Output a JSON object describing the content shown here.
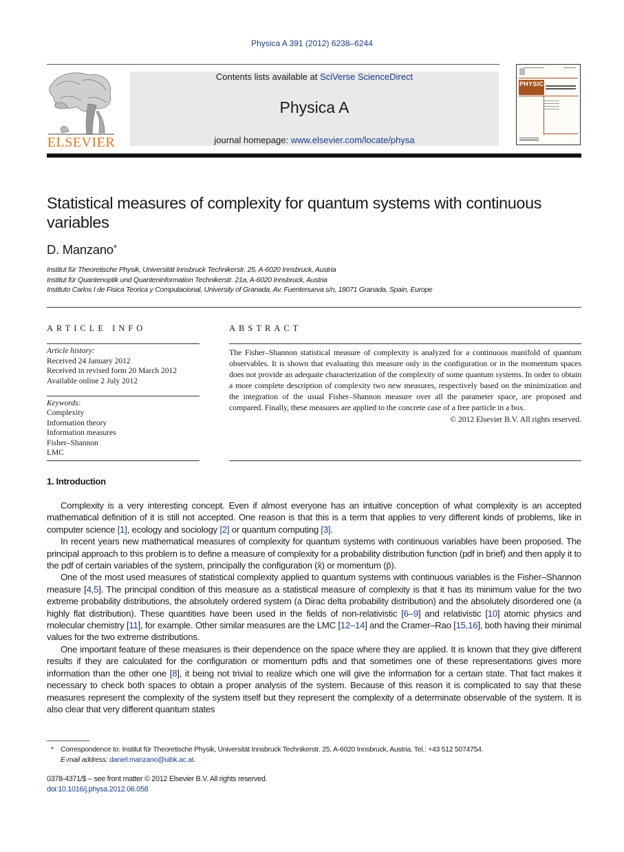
{
  "header": {
    "journal_ref": "Physica A 391 (2012) 6238–6244",
    "contents_prefix": "Contents lists available at ",
    "contents_link": "SciVerse ScienceDirect",
    "journal_title": "Physica A",
    "homepage_prefix": "journal homepage: ",
    "homepage_link": "www.elsevier.com/locate/physa",
    "publisher_wordmark": "ELSEVIER",
    "cover_title": "PHYSICA",
    "brand_color": "#e8741c",
    "link_color": "#1a3a8c"
  },
  "article": {
    "title": "Statistical measures of complexity for quantum systems with continuous variables",
    "author": "D. Manzano",
    "author_mark": "*",
    "affiliations": [
      "Institut für Theoretische Physik, Universität Innsbruck Technikerstr. 25, A-6020 Innsbruck, Austria",
      "Institut für Quantenoptik und Quanteninformation Technikerstr. 21a, A-6020 Innsbruck, Austria",
      "Instituto Carlos I de Fisica Teorica y Computacional, University of Granada, Av. Fuentenueva s/n, 18071 Granada, Spain, Europe"
    ]
  },
  "article_info": {
    "heading": "ARTICLE INFO",
    "history_label": "Article history:",
    "history": [
      "Received 24 January 2012",
      "Received in revised form 20 March 2012",
      "Available online 2 July 2012"
    ],
    "keywords_label": "Keywords:",
    "keywords": [
      "Complexity",
      "Information theory",
      "Information measures",
      "Fisher–Shannon",
      "LMC"
    ]
  },
  "abstract": {
    "heading": "ABSTRACT",
    "text": "The Fisher–Shannon statistical measure of complexity is analyzed for a continuous manifold of quantum observables. It is shown that evaluating this measure only in the configuration or in the momentum spaces does not provide an adequate characterization of the complexity of some quantum systems. In order to obtain a more complete description of complexity two new measures, respectively based on the minimization and the integration of the usual Fisher–Shannon measure over all the parameter space, are proposed and compared. Finally, these measures are applied to the concrete case of a free particle in a box.",
    "copyright": "© 2012 Elsevier B.V. All rights reserved."
  },
  "introduction": {
    "heading": "1.  Introduction",
    "p1": {
      "a": "Complexity is a very interesting concept. Even if almost everyone has an intuitive conception of what complexity is an accepted mathematical definition of it is still not accepted. One reason is that this is a term that applies to very different kinds of problems, like in computer science ",
      "c1": "[1]",
      "b": ", ecology and sociology ",
      "c2": "[2]",
      "c": " or quantum computing ",
      "c3": "[3]",
      "d": "."
    },
    "p2": "In recent years new mathematical measures of complexity for quantum systems with continuous variables have been proposed. The principal approach to this problem is to define a measure of complexity for a probability distribution function (pdf in brief) and then apply it to the pdf of certain variables of the system, principally the configuration (x̂) or momentum (p̂).",
    "p3": {
      "a": "One of the most used measures of statistical complexity applied to quantum systems with continuous variables is the Fisher–Shannon measure [",
      "c1": "4,5",
      "b": "]. The principal condition of this measure as a statistical measure of complexity is that it has its minimum value for the two extreme probability distributions, the absolutely ordered system (a Dirac delta probability distribution) and the absolutely disordered one (a highly flat distribution). These quantities have been used in the fields of non-relativistic [",
      "c2": "6–9",
      "c": "] and relativistic [",
      "c3": "10",
      "d": "] atomic physics and molecular chemistry [",
      "c4": "11",
      "e": "], for example. Other similar measures are the LMC [",
      "c5": "12–14",
      "f": "] and the Cramer–Rao [",
      "c6": "15,16",
      "g": "], both having their minimal values for the two extreme distributions."
    },
    "p4": {
      "a": "One important feature of these measures is their dependence on the space where they are applied. It is known that they give different results if they are calculated for the configuration or momentum pdfs and that sometimes one of these representations gives more information than the other one [",
      "c1": "8",
      "b": "], it being not trivial to realize which one will give the information for a certain state. That fact makes it necessary to check both spaces to obtain a proper analysis of the system. Because of this reason it is complicated to say that these measures represent the complexity of the system itself but they represent the complexity of a determinate observable of the system. It is also clear that very different quantum states"
    }
  },
  "footnote": {
    "mark": "*",
    "correspondence": "Correspondence to: Institut für Theoretische Physik, Universität Innsbruck Technikerstr. 25, A-6020 Innsbruck, Austria. Tel.: +43 512 5074754.",
    "email_label": "E-mail address:",
    "email": "daniel.manzano@uibk.ac.at",
    "email_suffix": "."
  },
  "front_matter": {
    "issn": "0378-4371/$ – see front matter © 2012 Elsevier B.V. All rights reserved.",
    "doi": "doi:10.1016/j.physa.2012.06.058"
  }
}
